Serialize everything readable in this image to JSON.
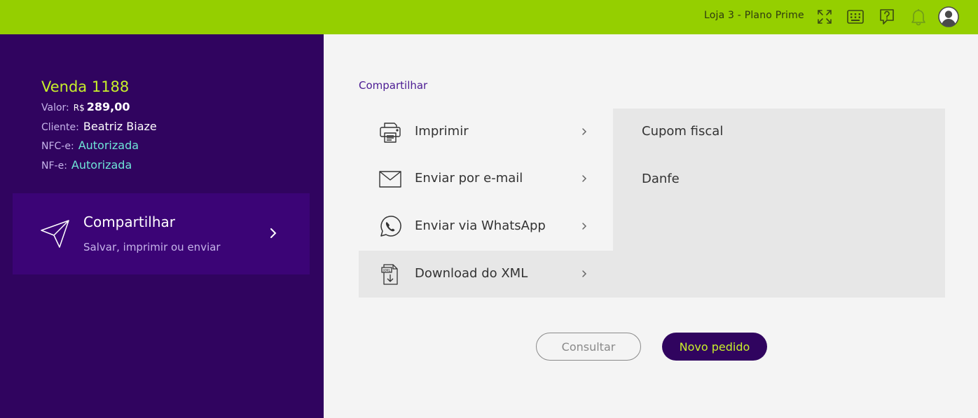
{
  "topbar": {
    "store_label": "Loja 3 - Plano Prime",
    "icons": [
      "fullscreen-icon",
      "keyboard-icon",
      "help-icon",
      "bell-icon",
      "user-avatar-icon"
    ]
  },
  "sale": {
    "title": "Venda 1188",
    "valor_label": "Valor:",
    "currency": "R$",
    "amount": "289,00",
    "cliente_label": "Cliente:",
    "cliente": "Beatriz Biaze",
    "nfce_label": "NFC-e:",
    "nfce_status": "Autorizada",
    "nfe_label": "NF-e:",
    "nfe_status": "Autorizada"
  },
  "share_card": {
    "title": "Compartilhar",
    "subtitle": "Salvar, imprimir ou enviar",
    "icon": "paper-plane-icon"
  },
  "main": {
    "section_title": "Compartilhar",
    "options": [
      {
        "label": "Imprimir",
        "icon": "printer-icon"
      },
      {
        "label": "Enviar por e-mail",
        "icon": "envelope-icon"
      },
      {
        "label": "Enviar via WhatsApp",
        "icon": "whatsapp-icon"
      },
      {
        "label": "Download do XML",
        "icon": "xml-download-icon",
        "selected": true
      }
    ],
    "submenu": [
      "Cupom fiscal",
      "Danfe"
    ]
  },
  "actions": {
    "consultar": "Consultar",
    "novo_pedido": "Novo pedido"
  },
  "colors": {
    "topbar": "#95cf00",
    "sidebar": "#30045f",
    "accent_lime": "#c8f02a",
    "status_cyan": "#6fe6d8"
  }
}
